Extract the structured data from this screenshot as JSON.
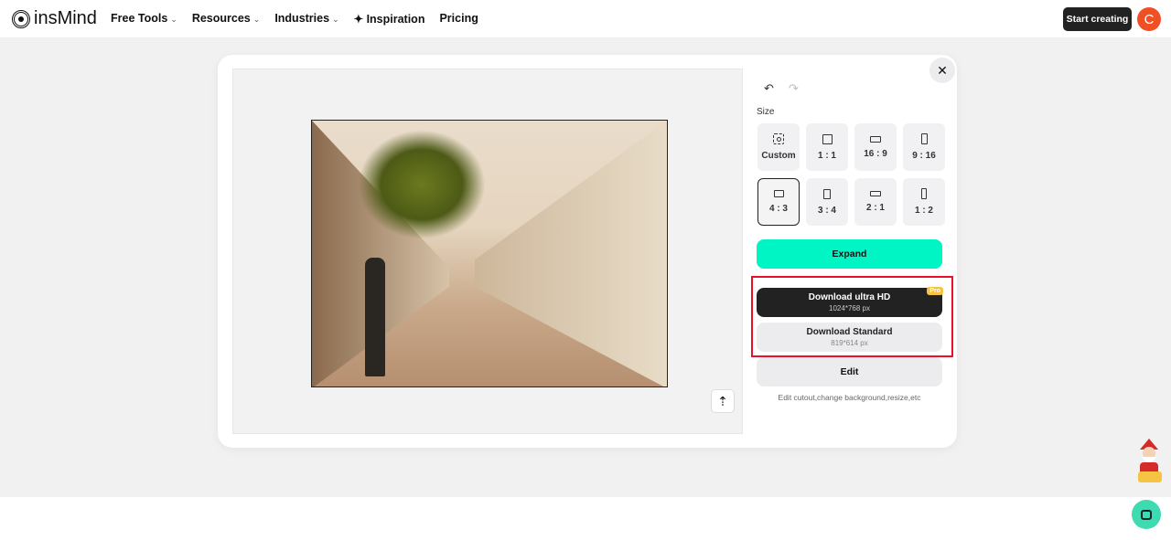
{
  "nav": {
    "brand": "insMind",
    "items": [
      {
        "label": "Free Tools",
        "dropdown": true
      },
      {
        "label": "Resources",
        "dropdown": true
      },
      {
        "label": "Industries",
        "dropdown": true
      },
      {
        "label": "Inspiration",
        "icon": "sparkle-icon"
      },
      {
        "label": "Pricing"
      }
    ],
    "start_label": "Start creating",
    "avatar_letter": "C"
  },
  "editor": {
    "size_label": "Size",
    "sizes": [
      {
        "label": "Custom",
        "icon": "custom"
      },
      {
        "label": "1 : 1"
      },
      {
        "label": "16 : 9"
      },
      {
        "label": "9 : 16"
      },
      {
        "label": "4 : 3",
        "selected": true
      },
      {
        "label": "3 : 4"
      },
      {
        "label": "2 : 1"
      },
      {
        "label": "1 : 2"
      }
    ],
    "expand_label": "Expand",
    "download_hd": {
      "label": "Download ultra HD",
      "size": "1024*768 px",
      "badge": "Pro"
    },
    "download_std": {
      "label": "Download Standard",
      "size": "819*614 px"
    },
    "edit_label": "Edit",
    "edit_hint": "Edit cutout,change background,resize,etc"
  },
  "colors": {
    "accent": "#00f5c4",
    "highlight": "#e8102a",
    "avatar": "#f04e23"
  }
}
